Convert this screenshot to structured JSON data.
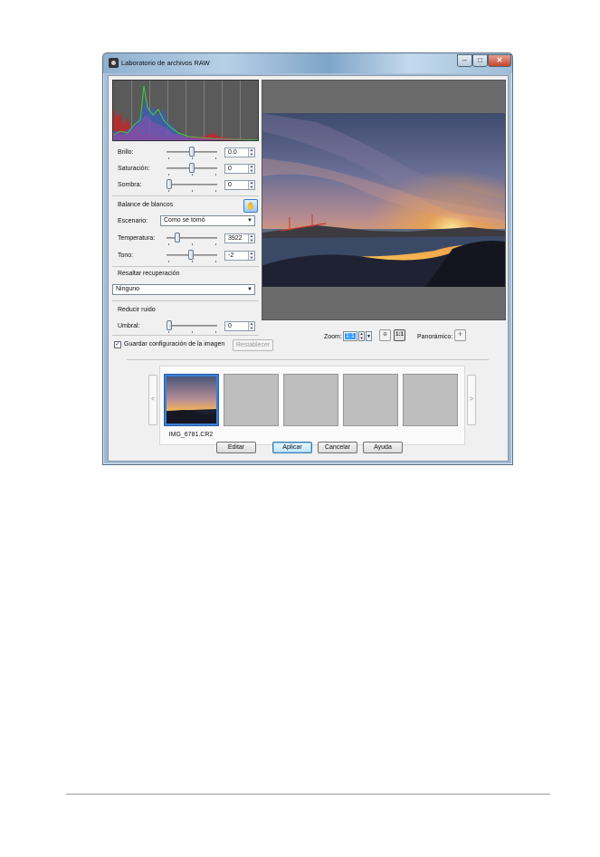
{
  "window": {
    "title": "Laboratorio de archivos RAW",
    "controls": {
      "minimize": "–",
      "maximize": "□",
      "close": "✕"
    }
  },
  "adjustments": {
    "brightness": {
      "label": "Brillo:",
      "value": "0.0",
      "position": 0.5
    },
    "saturation": {
      "label": "Saturación:",
      "value": "0",
      "position": 0.5
    },
    "shadow": {
      "label": "Sombra:",
      "value": "0",
      "position": 0.0
    }
  },
  "white_balance": {
    "title": "Balance de blancos",
    "scene": {
      "label": "Escenario:",
      "value": "Como se tomó"
    },
    "temperature": {
      "label": "Temperatura:",
      "value": "3922",
      "position": 0.18
    },
    "tint": {
      "label": "Tono:",
      "value": "-2",
      "position": 0.48
    },
    "eyedropper_icon": "eyedropper-icon"
  },
  "highlight": {
    "title": "Resaltar recuperación",
    "value": "Ninguno"
  },
  "noise": {
    "title": "Reducir ruido",
    "threshold": {
      "label": "Umbral:",
      "value": "0",
      "position": 0.0
    }
  },
  "save_settings": {
    "label": "Guardar configuración de la imagen",
    "checked": true
  },
  "reset_button": "Restablecer",
  "zoom": {
    "label": "Zoom:",
    "value": "1:1"
  },
  "pan": {
    "label": "Panorámico:"
  },
  "filmstrip": {
    "items": [
      {
        "name": "IMG_6781.CR2",
        "selected": true
      }
    ],
    "prev": "<",
    "next": ">"
  },
  "buttons": {
    "edit": "Editar",
    "apply": "Aplicar",
    "cancel": "Cancelar",
    "help": "Ayuda"
  }
}
